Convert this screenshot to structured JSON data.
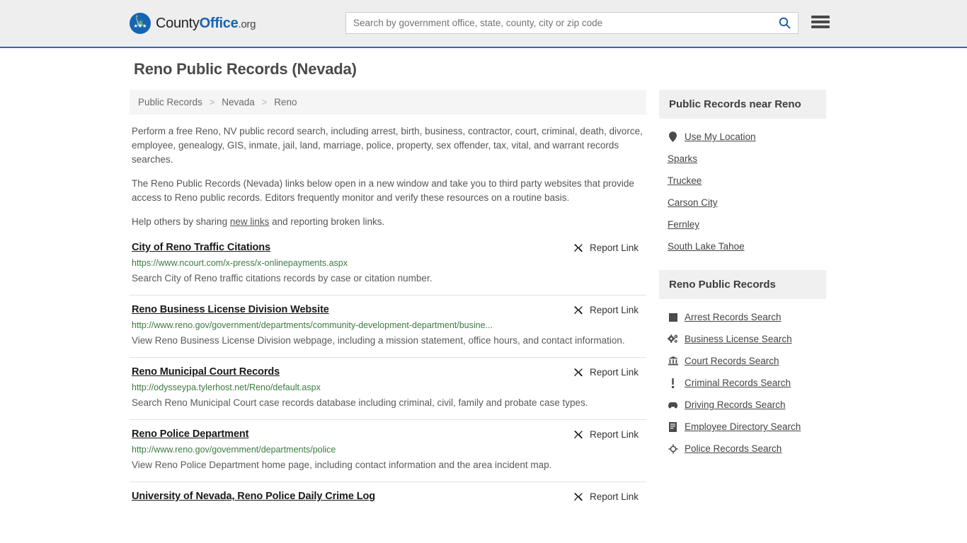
{
  "header": {
    "logo": {
      "brand_county": "County",
      "brand_office": "Office",
      "brand_org": ".org",
      "icon": "eagle-stars-logo"
    },
    "search": {
      "placeholder": "Search by government office, state, county, city or zip code",
      "value": "",
      "search_icon": "search-icon"
    },
    "menu_icon": "hamburger-menu-icon",
    "accent_color": "#1665b3",
    "background_color": "#eeeeee"
  },
  "page": {
    "title": "Reno Public Records (Nevada)"
  },
  "breadcrumb": {
    "items": [
      "Public Records",
      "Nevada",
      "Reno"
    ],
    "separator": ">"
  },
  "intro": {
    "paragraph1": "Perform a free Reno, NV public record search, including arrest, birth, business, contractor, court, criminal, death, divorce, employee, genealogy, GIS, inmate, jail, land, marriage, police, property, sex offender, tax, vital, and warrant records searches.",
    "paragraph2": "The Reno Public Records (Nevada) links below open in a new window and take you to third party websites that provide access to Reno public records. Editors frequently monitor and verify these resources on a routine basis.",
    "paragraph3_prefix": "Help others by sharing ",
    "paragraph3_link": "new links",
    "paragraph3_suffix": " and reporting broken links."
  },
  "results": {
    "report_label": "Report Link",
    "report_icon": "broken-link-icon",
    "items": [
      {
        "title": "City of Reno Traffic Citations",
        "url": "https://www.ncourt.com/x-press/x-onlinepayments.aspx",
        "description": "Search City of Reno traffic citations records by case or citation number."
      },
      {
        "title": "Reno Business License Division Website",
        "url": "http://www.reno.gov/government/departments/community-development-department/busine...",
        "description": "View Reno Business License Division webpage, including a mission statement, office hours, and contact information."
      },
      {
        "title": "Reno Municipal Court Records",
        "url": "http://odysseypa.tylerhost.net/Reno/default.aspx",
        "description": "Search Reno Municipal Court case records database including criminal, civil, family and probate case types."
      },
      {
        "title": "Reno Police Department",
        "url": "http://www.reno.gov/government/departments/police",
        "description": "View Reno Police Department home page, including contact information and the area incident map."
      },
      {
        "title": "University of Nevada, Reno Police Daily Crime Log",
        "url": "",
        "description": ""
      }
    ]
  },
  "sidebar": {
    "nearby": {
      "heading": "Public Records near Reno",
      "items": [
        {
          "label": "Use My Location",
          "icon": "map-pin-icon"
        },
        {
          "label": "Sparks",
          "icon": ""
        },
        {
          "label": "Truckee",
          "icon": ""
        },
        {
          "label": "Carson City",
          "icon": ""
        },
        {
          "label": "Fernley",
          "icon": ""
        },
        {
          "label": "South Lake Tahoe",
          "icon": ""
        }
      ]
    },
    "records": {
      "heading": "Reno Public Records",
      "items": [
        {
          "label": "Arrest Records Search",
          "icon": "square-icon"
        },
        {
          "label": "Business License Search",
          "icon": "gears-icon"
        },
        {
          "label": "Court Records Search",
          "icon": "bank-icon"
        },
        {
          "label": "Criminal Records Search",
          "icon": "exclamation-icon"
        },
        {
          "label": "Driving Records Search",
          "icon": "car-icon"
        },
        {
          "label": "Employee Directory Search",
          "icon": "book-icon"
        },
        {
          "label": "Police Records Search",
          "icon": "police-badge-icon"
        }
      ]
    }
  }
}
